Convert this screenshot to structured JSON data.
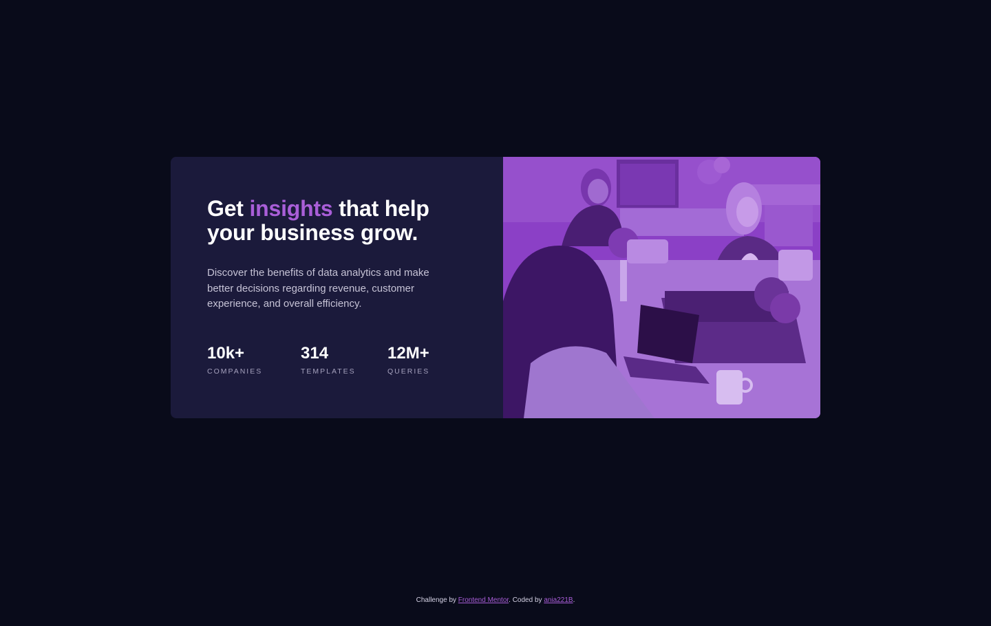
{
  "card": {
    "headline": {
      "before": "Get ",
      "accent": "insights",
      "after": " that help your business grow."
    },
    "description": "Discover the benefits of data analytics and make better decisions regarding revenue, customer experience, and overall efficiency.",
    "stats": [
      {
        "value": "10k+",
        "label": "COMPANIES"
      },
      {
        "value": "314",
        "label": "TEMPLATES"
      },
      {
        "value": "12M+",
        "label": "QUERIES"
      }
    ],
    "image": {
      "icon": "office-workers-photo"
    }
  },
  "footer": {
    "prefix": "Challenge by ",
    "link1": "Frontend Mentor",
    "middle": ". Coded by ",
    "link2": "ania221B",
    "suffix": "."
  },
  "colors": {
    "background": "#090b1a",
    "card": "#1b1a3b",
    "accent": "#a95ed8",
    "image_tint": "#8a3fc4"
  }
}
